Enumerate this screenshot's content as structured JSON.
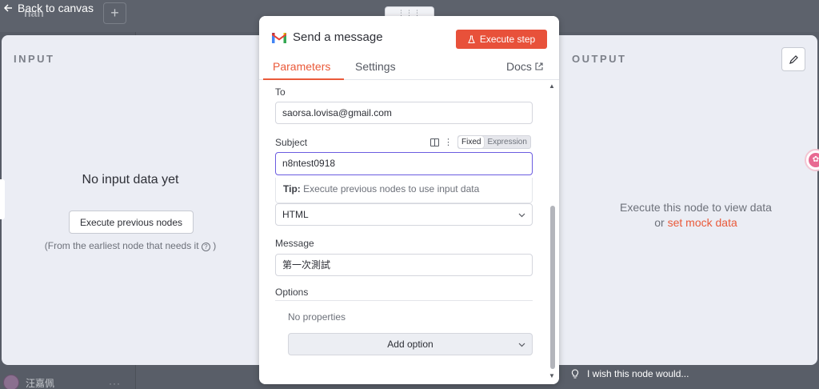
{
  "app": {
    "back_label": "Back to canvas",
    "workflow_name": "nan",
    "user_name": "汪嘉佩",
    "user_menu": "···"
  },
  "input_panel": {
    "title": "INPUT",
    "no_data": "No input data yet",
    "exec_prev_label": "Execute previous nodes",
    "note_prefix": "(From the earliest node that needs it",
    "note_suffix": ")"
  },
  "node": {
    "title": "Send a message",
    "execute_label": "Execute step",
    "tabs": {
      "parameters": "Parameters",
      "settings": "Settings",
      "docs": "Docs"
    },
    "fields": {
      "to": {
        "label": "To",
        "value": "saorsa.lovisa@gmail.com"
      },
      "subject": {
        "label": "Subject",
        "value": "n8ntest0918",
        "mode_fixed": "Fixed",
        "mode_expression": "Expression"
      },
      "tip_label": "Tip:",
      "tip_text": "Execute previous nodes to use input data",
      "email_type": {
        "value": "HTML"
      },
      "message": {
        "label": "Message",
        "value": "第一次測試"
      },
      "options": {
        "label": "Options",
        "empty": "No properties",
        "add_label": "Add option"
      }
    }
  },
  "output_panel": {
    "title": "OUTPUT",
    "msg_line1": "Execute this node to view data",
    "msg_or": "or",
    "mock_link": "set mock data"
  },
  "footer": {
    "wish_label": "I wish this node would..."
  },
  "colors": {
    "accent": "#ea5a3a",
    "execute_bg": "#e8513a",
    "focus": "#6b5ce0",
    "panel_bg": "#ebedf4"
  }
}
